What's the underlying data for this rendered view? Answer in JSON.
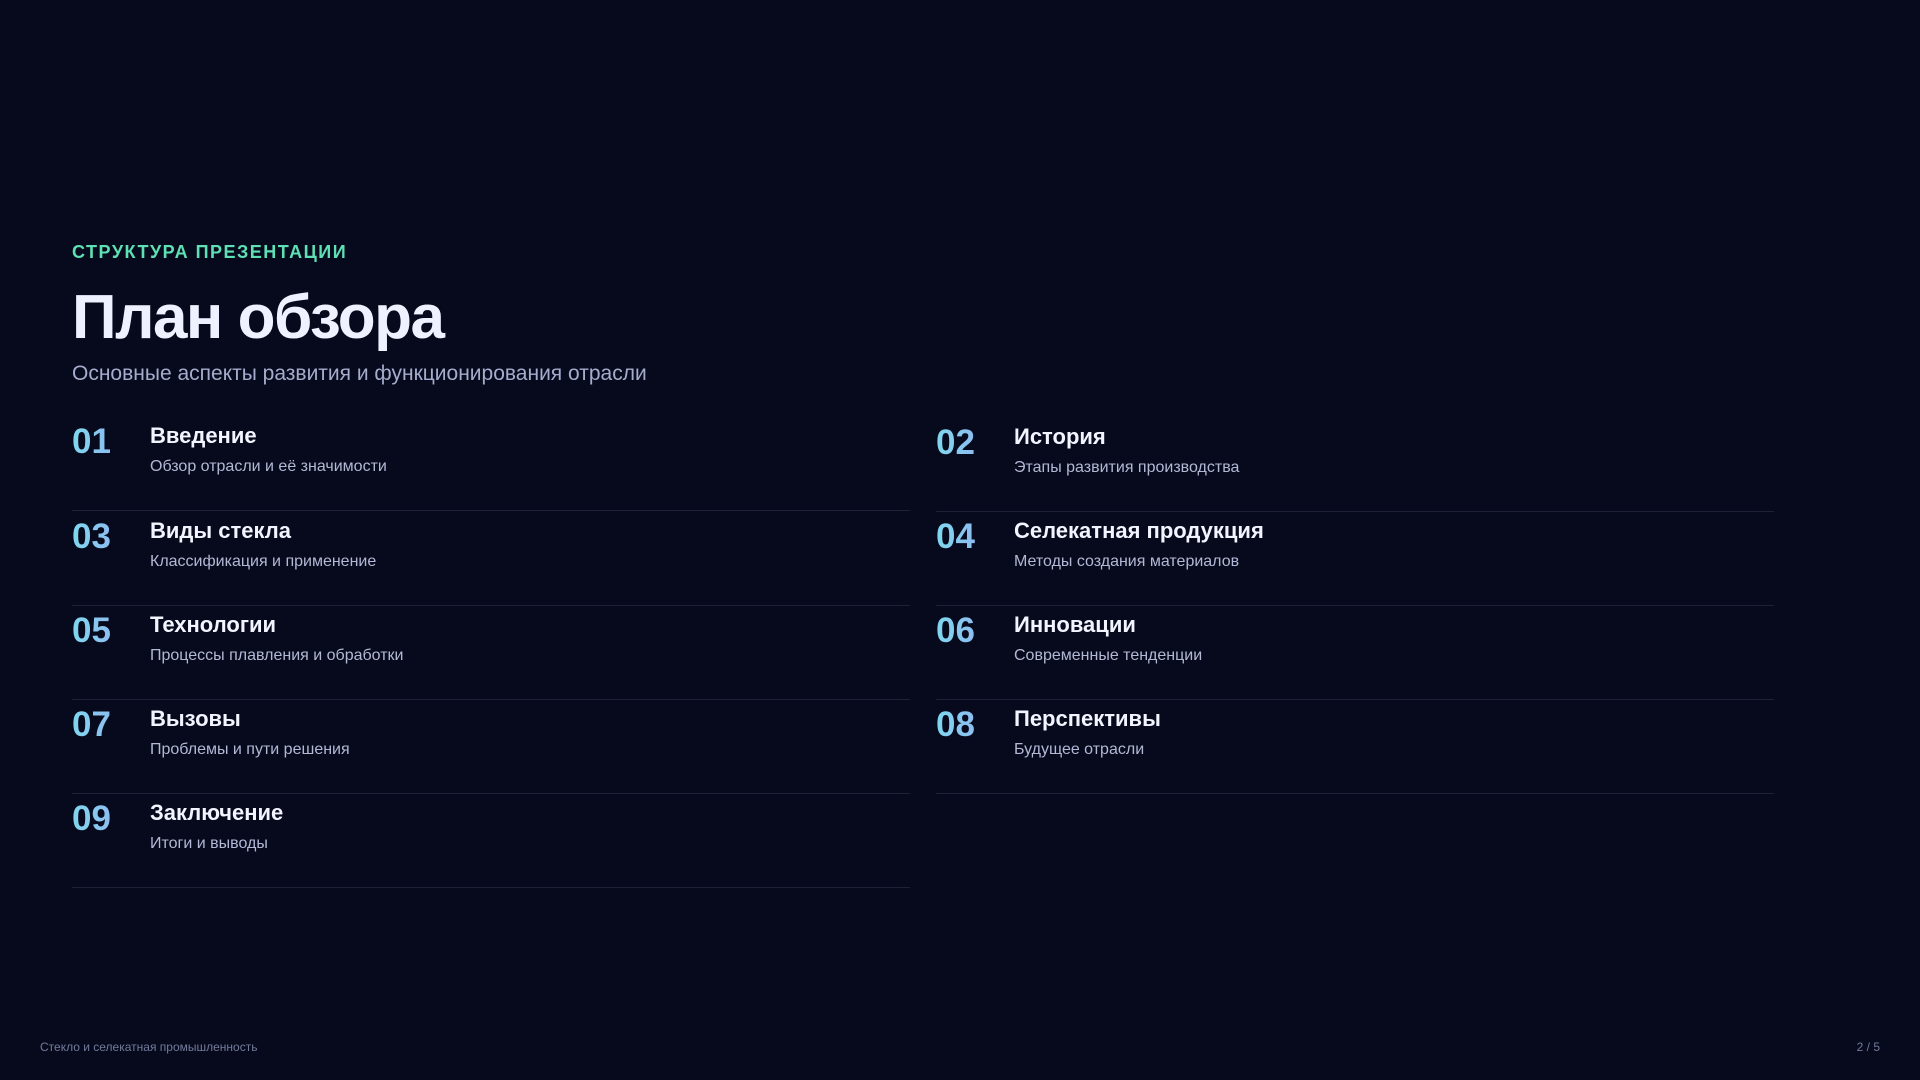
{
  "header": {
    "eyebrow": "СТРУКТУРА ПРЕЗЕНТАЦИИ",
    "title": "План обзора",
    "subtitle": "Основные аспекты развития и функционирования отрасли"
  },
  "items": [
    {
      "num": "01",
      "title": "Введение",
      "desc": "Обзор отрасли и её значимости"
    },
    {
      "num": "02",
      "title": "История",
      "desc": "Этапы развития производства"
    },
    {
      "num": "03",
      "title": "Виды стекла",
      "desc": "Классификация и применение"
    },
    {
      "num": "04",
      "title": "Селекатная продукция",
      "desc": "Методы создания материалов"
    },
    {
      "num": "05",
      "title": "Технологии",
      "desc": "Процессы плавления и обработки"
    },
    {
      "num": "06",
      "title": "Инновации",
      "desc": "Современные тенденции"
    },
    {
      "num": "07",
      "title": "Вызовы",
      "desc": "Проблемы и пути решения"
    },
    {
      "num": "08",
      "title": "Перспективы",
      "desc": "Будущее отрасли"
    },
    {
      "num": "09",
      "title": "Заключение",
      "desc": "Итоги и выводы"
    }
  ],
  "footer": {
    "left": "Стекло и селекатная промышленность",
    "page": "2 / 5"
  },
  "colors": {
    "background": "#070a1c",
    "accent": "#5ee0b4",
    "number_gradient_start": "#7fd7ee",
    "number_gradient_end": "#9aa4f4"
  }
}
